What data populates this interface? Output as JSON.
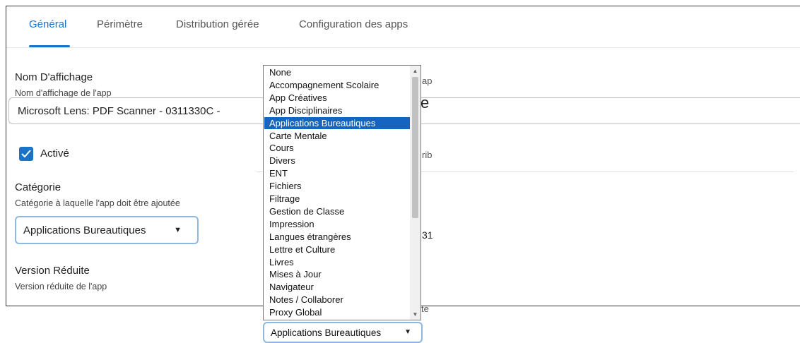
{
  "tabs": [
    {
      "label": "Général",
      "active": true
    },
    {
      "label": "Périmètre"
    },
    {
      "label": "Distribution gérée"
    },
    {
      "label": "Configuration des apps"
    }
  ],
  "display_name": {
    "label": "Nom D'affichage",
    "sublabel": "Nom d'affichage de l'app",
    "value": "Microsoft Lens: PDF Scanner - 0311330C -"
  },
  "enabled": {
    "label": "Activé",
    "checked": true
  },
  "category": {
    "label": "Catégorie",
    "sublabel": "Catégorie à laquelle l'app doit être ajoutée",
    "value": "Applications Bureautiques"
  },
  "short_version": {
    "label": "Version Réduite",
    "sublabel": "Version réduite de l'app"
  },
  "dropdown": {
    "options": [
      "None",
      "Accompagnement Scolaire",
      "App Créatives",
      "App Disciplinaires",
      "Applications Bureautiques",
      "Carte Mentale",
      "Cours",
      "Divers",
      "ENT",
      "Fichiers",
      "Filtrage",
      "Gestion de Classe",
      "Impression",
      "Langues étrangères",
      "Lettre et Culture",
      "Livres",
      "Mises à Jour",
      "Navigateur",
      "Notes / Collaborer",
      "Proxy Global"
    ],
    "selected_index": 4,
    "selected_value": "Applications Bureautiques"
  },
  "partials": {
    "right_top": "ap",
    "right_big": "e",
    "right_mid": "rib",
    "right_num": "31",
    "right_bottom": "te"
  },
  "colors": {
    "accent": "#1a73c7",
    "selection": "#1565c0"
  }
}
